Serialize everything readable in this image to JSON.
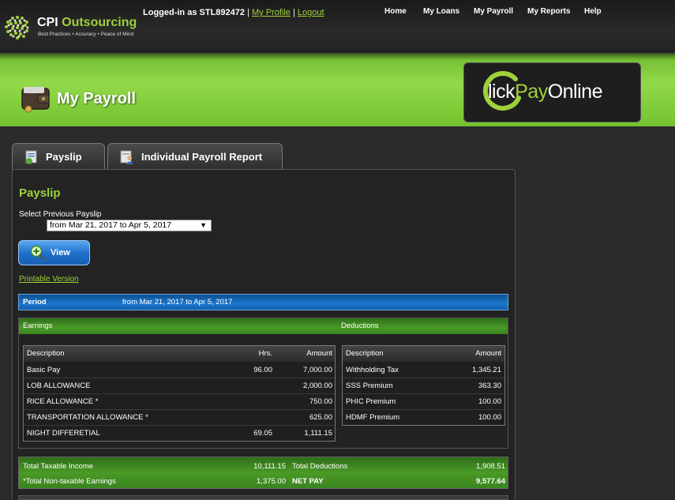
{
  "header": {
    "brand_name": "CPI",
    "brand_name_accent": "Outsourcing",
    "brand_tagline": "Best Practices • Accuracy • Peace of Mind",
    "login_prefix": "Logged-in as",
    "username": "STL892472",
    "separator": "|",
    "my_profile": "My Profile",
    "logout": "Logout",
    "nav": [
      "Home",
      "My Loans",
      "My Payroll",
      "My Reports",
      "Help"
    ]
  },
  "banner": {
    "title": "My Payroll",
    "clickpay_a": "lick",
    "clickpay_b": "Pay",
    "clickpay_c": "Online"
  },
  "tabs": [
    {
      "label": "Payslip"
    },
    {
      "label": "Individual Payroll Report"
    }
  ],
  "payslip": {
    "title": "Payslip",
    "select_label": "Select Previous Payslip",
    "selected_period": "from Mar 21, 2017 to Apr 5, 2017",
    "view_label": "View",
    "printable": "Printable Version",
    "period_label": "Period",
    "period_value": "from Mar 21, 2017 to Apr 5, 2017"
  },
  "earnings": {
    "heading": "Earnings",
    "columns": [
      "Description",
      "Hrs.",
      "Amount"
    ],
    "rows": [
      {
        "desc": "Basic Pay",
        "hrs": "96.00",
        "amount": "7,000.00"
      },
      {
        "desc": "LOB ALLOWANCE",
        "hrs": "",
        "amount": "2,000.00"
      },
      {
        "desc": "RICE ALLOWANCE *",
        "hrs": "",
        "amount": "750.00"
      },
      {
        "desc": "TRANSPORTATION ALLOWANCE *",
        "hrs": "",
        "amount": "625.00"
      },
      {
        "desc": "NIGHT DIFFERETIAL",
        "hrs": "69.05",
        "amount": "1,111.15"
      }
    ]
  },
  "deductions": {
    "heading": "Deductions",
    "columns": [
      "Description",
      "Amount"
    ],
    "rows": [
      {
        "desc": "Withholding Tax",
        "amount": "1,345.21"
      },
      {
        "desc": "SSS Premium",
        "amount": "363.30"
      },
      {
        "desc": "PHIC Premium",
        "amount": "100.00"
      },
      {
        "desc": "HDMF Premium",
        "amount": "100.00"
      }
    ]
  },
  "totals": {
    "taxable_label": "Total Taxable Income",
    "taxable_value": "10,111.15",
    "deductions_label": "Total Deductions",
    "deductions_value": "1,908.51",
    "nontaxable_label": "*Total Non-taxable Earnings",
    "nontaxable_value": "1,375.00",
    "netpay_label": "NET PAY",
    "netpay_value": "9,577.64"
  },
  "colors": {
    "accent_green": "#9fd13a",
    "banner_green": "#8ad03f",
    "period_blue": "#1c78cf"
  }
}
